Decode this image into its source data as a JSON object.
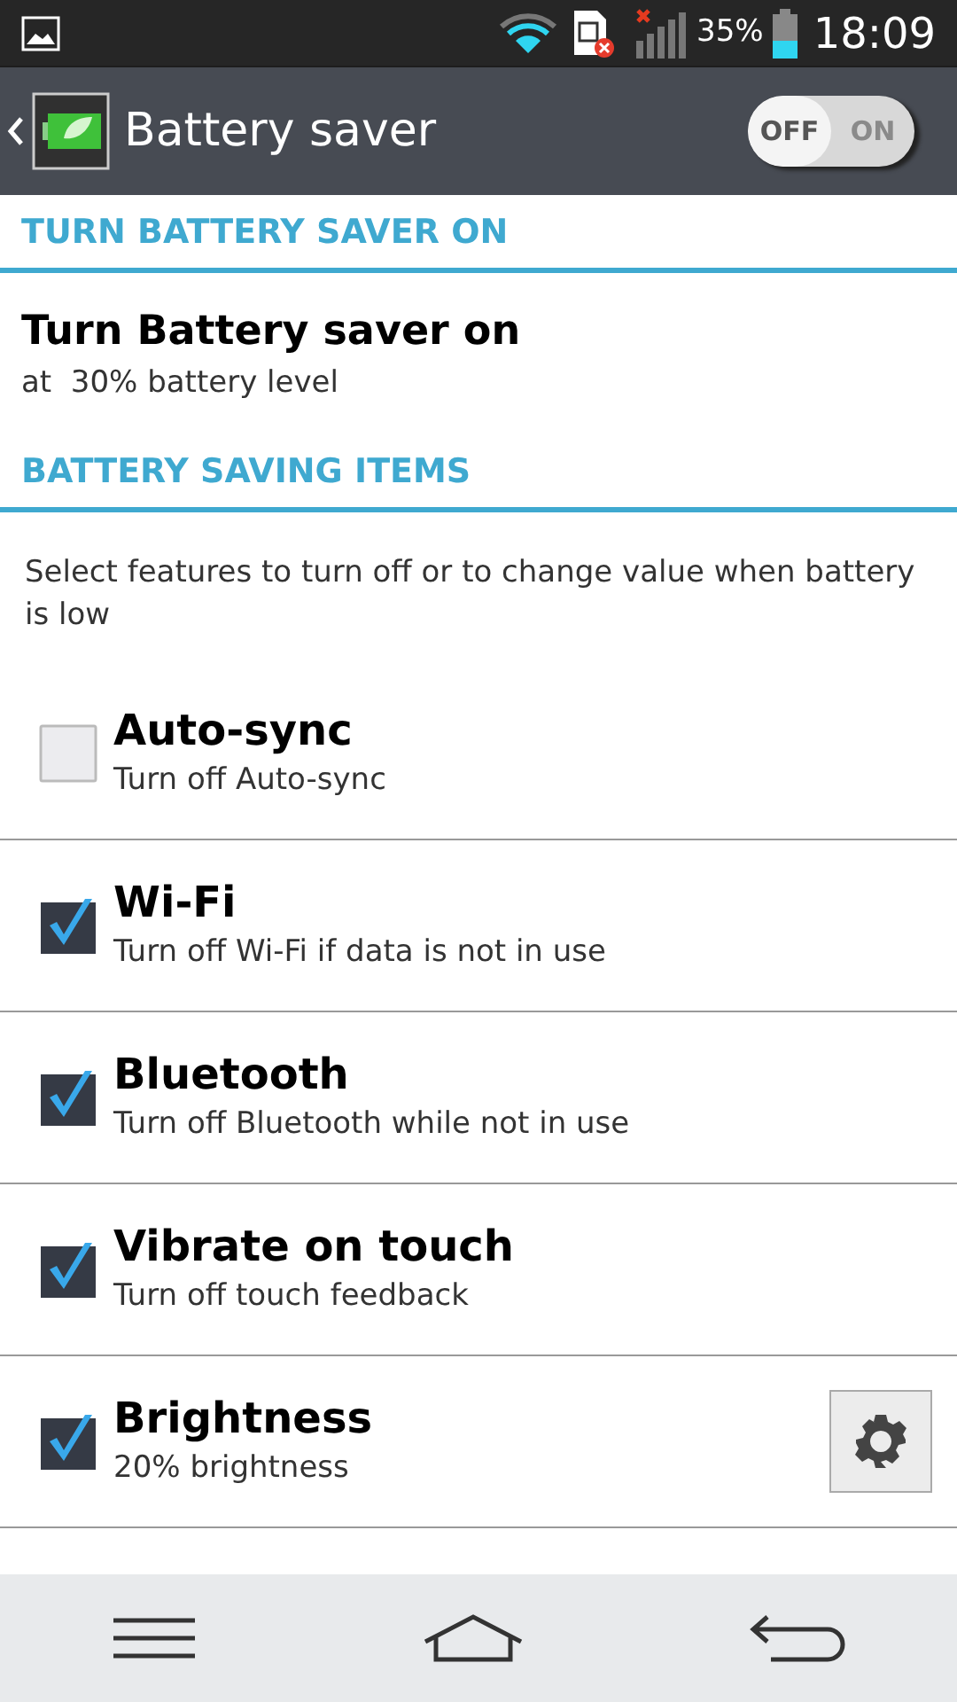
{
  "status_bar": {
    "battery": "35%",
    "time": "18:09"
  },
  "action_bar": {
    "title": "Battery saver",
    "switch": {
      "off_label": "OFF",
      "on_label": "ON",
      "on": false
    }
  },
  "sections": [
    {
      "header": "TURN BATTERY SAVER ON",
      "title": "Turn Battery saver on",
      "subtitle": "at  30% battery level"
    },
    {
      "header": "BATTERY SAVING ITEMS",
      "description": "Select features to turn off or to change value when battery is low"
    }
  ],
  "items": [
    {
      "title": "Auto-sync",
      "subtitle": "Turn off Auto-sync",
      "checked": false,
      "settings": false
    },
    {
      "title": "Wi-Fi",
      "subtitle": "Turn off Wi-Fi if data is not in use",
      "checked": true,
      "settings": false
    },
    {
      "title": "Bluetooth",
      "subtitle": "Turn off Bluetooth while not in use",
      "checked": true,
      "settings": false
    },
    {
      "title": "Vibrate on touch",
      "subtitle": "Turn off touch feedback",
      "checked": true,
      "settings": false
    },
    {
      "title": "Brightness",
      "subtitle": "20% brightness",
      "checked": true,
      "settings": true
    }
  ]
}
